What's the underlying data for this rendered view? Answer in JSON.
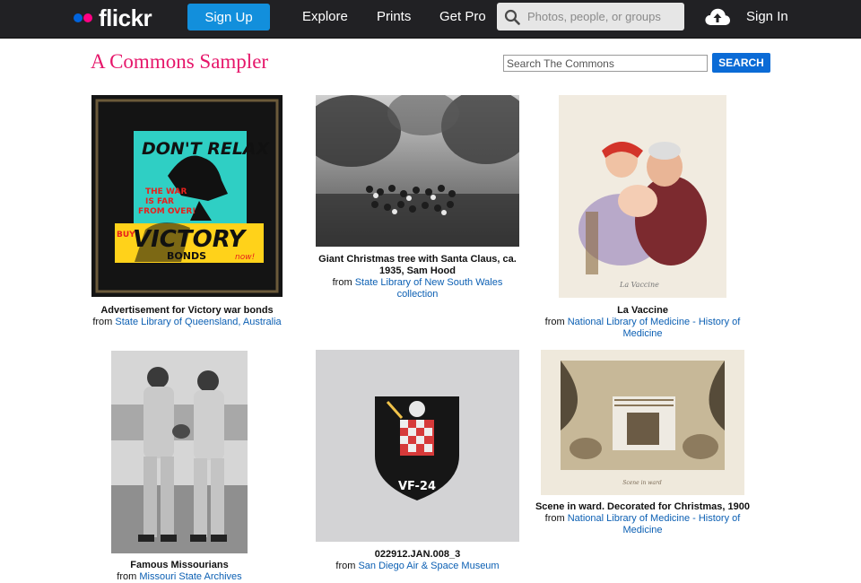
{
  "nav": {
    "logo_text": "flickr",
    "signup_label": "Sign Up",
    "explore_label": "Explore",
    "prints_label": "Prints",
    "getpro_label": "Get Pro",
    "search_placeholder": "Photos, people, or groups",
    "signin_label": "Sign In",
    "colors": {
      "bar": "#212124",
      "signup": "#128fdc",
      "logo_blue": "#0063dc",
      "logo_pink": "#ff0084"
    }
  },
  "page": {
    "title": "A Commons Sampler",
    "title_color": "#e6166a",
    "search_placeholder": "Search The Commons",
    "search_button": "SEARCH"
  },
  "photos": [
    {
      "title": "Advertisement for Victory war bonds",
      "from": "from",
      "source": "State Library of Queensland, Australia",
      "poster_lines": [
        "DON'T RELAX",
        "THE WAR",
        "IS FAR",
        "FROM OVER!",
        "BUY",
        "VICTORY",
        "BONDS",
        "now!"
      ]
    },
    {
      "title": "Giant Christmas tree with Santa Claus, ca. 1935, Sam Hood",
      "from": "from",
      "source": "State Library of New South Wales collection"
    },
    {
      "title": "La Vaccine",
      "from": "from",
      "source": "National Library of Medicine - History of Medicine"
    },
    {
      "title": "Famous Missourians",
      "from": "from",
      "source": "Missouri State Archives"
    },
    {
      "title": "022912.JAN.008_3",
      "from": "from",
      "source": "San Diego Air & Space Museum",
      "patch_text": "VF-24"
    },
    {
      "title": "Scene in ward. Decorated for Christmas, 1900",
      "from": "from",
      "source": "National Library of Medicine - History of Medicine"
    }
  ]
}
